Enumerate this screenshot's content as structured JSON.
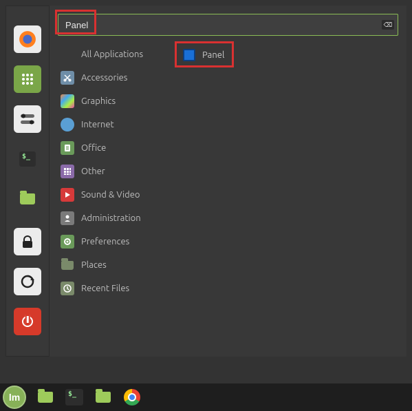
{
  "search": {
    "value": "Panel"
  },
  "categories": [
    {
      "label": "All Applications",
      "icon": "apps"
    },
    {
      "label": "Accessories",
      "icon": "scissors"
    },
    {
      "label": "Graphics",
      "icon": "palette"
    },
    {
      "label": "Internet",
      "icon": "globe"
    },
    {
      "label": "Office",
      "icon": "document"
    },
    {
      "label": "Other",
      "icon": "grid"
    },
    {
      "label": "Sound & Video",
      "icon": "play"
    },
    {
      "label": "Administration",
      "icon": "admin"
    },
    {
      "label": "Preferences",
      "icon": "gear"
    },
    {
      "label": "Places",
      "icon": "folder"
    },
    {
      "label": "Recent Files",
      "icon": "recent"
    }
  ],
  "results": [
    {
      "label": "Panel",
      "icon": "panel"
    }
  ],
  "favorites": {
    "top": [
      {
        "name": "firefox",
        "bg": "#ececec"
      },
      {
        "name": "apps-grid",
        "bg": "#7aa648"
      },
      {
        "name": "toggle",
        "bg": "#ececec"
      },
      {
        "name": "terminal",
        "bg": "none"
      },
      {
        "name": "files",
        "bg": "none"
      }
    ],
    "bottom": [
      {
        "name": "lock",
        "bg": "#ececec"
      },
      {
        "name": "logout",
        "bg": "#ececec"
      },
      {
        "name": "shutdown",
        "bg": "#d63a2a"
      }
    ]
  },
  "taskbar": [
    {
      "name": "files",
      "icon": "folder-green"
    },
    {
      "name": "terminal",
      "icon": "terminal"
    },
    {
      "name": "file-manager",
      "icon": "folder-green"
    },
    {
      "name": "chrome",
      "icon": "chrome"
    }
  ]
}
